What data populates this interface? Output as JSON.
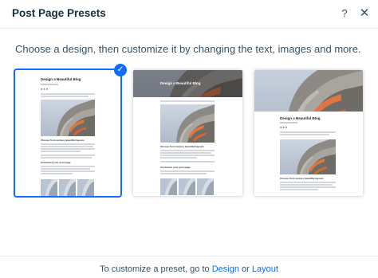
{
  "header": {
    "title": "Post Page Presets",
    "help_label": "?",
    "close_label": "✕"
  },
  "instructions": "Choose a design, then customize it by changing the text, images and more.",
  "presets": [
    {
      "blog_title": "Design a Beautiful Blog",
      "subtitle": "Choose from various beautiful layouts",
      "section": "Customize your post page",
      "selected": true
    },
    {
      "blog_title": "Design a Beautiful Blog",
      "subtitle": "Choose from various beautiful layouts",
      "section": "Customize your post page",
      "selected": false
    },
    {
      "blog_title": "Design a Beautiful Blog",
      "subtitle": "Choose from various beautiful layouts",
      "selected": false
    }
  ],
  "footer": {
    "prefix": "To customize a preset, go to",
    "design_link": "Design",
    "conjunction": "or",
    "layout_link": "Layout"
  },
  "colors": {
    "accent": "#116dff",
    "text": "#32536a",
    "title": "#162d3d"
  }
}
